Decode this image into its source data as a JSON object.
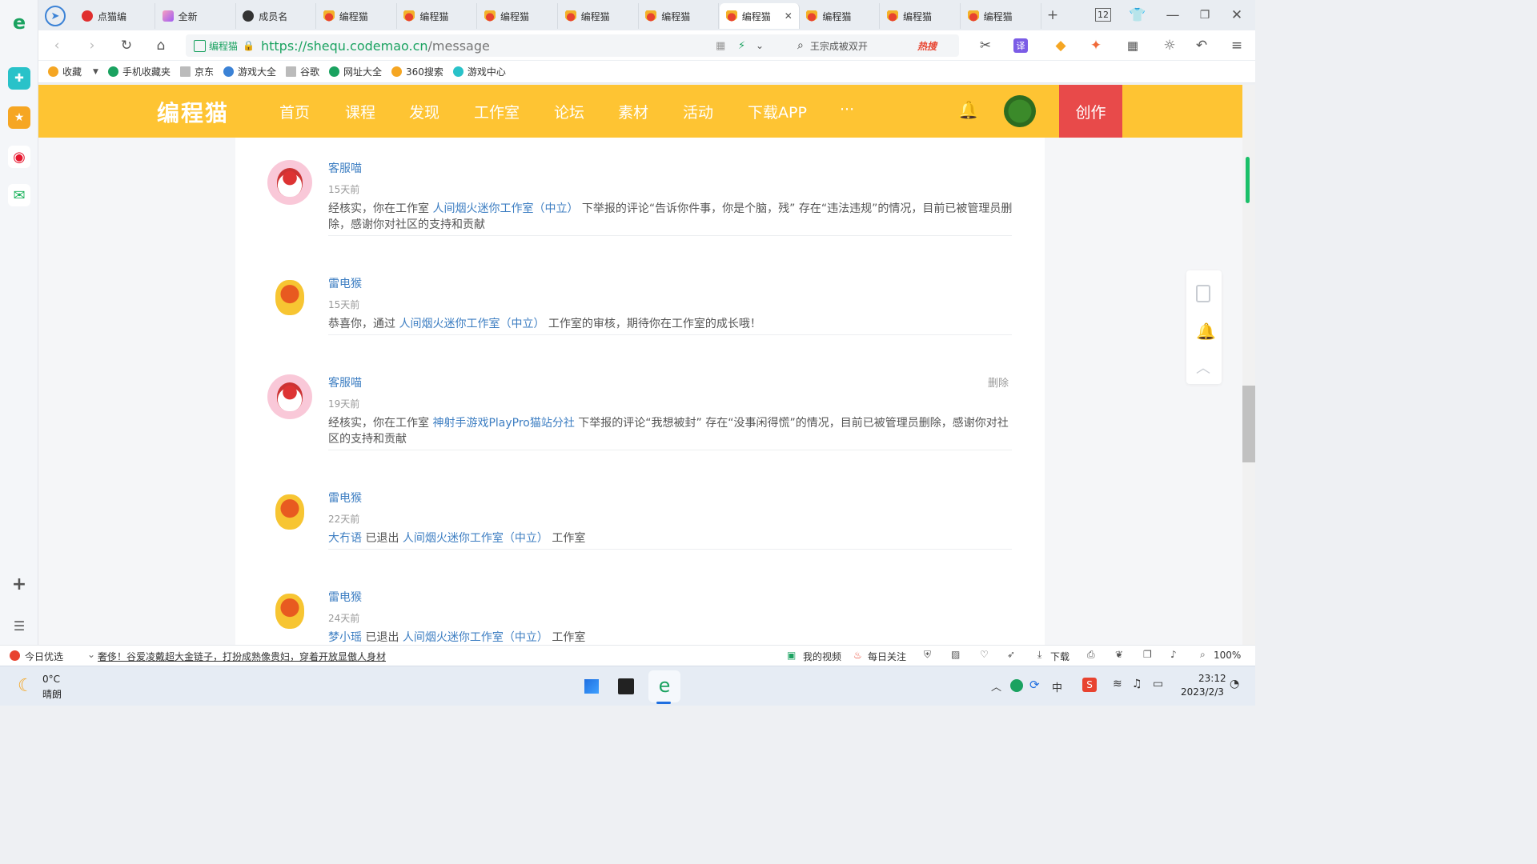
{
  "browser": {
    "tabs": [
      {
        "label": "点猫编",
        "icon": "red-play-icon",
        "active": false
      },
      {
        "label": "全新",
        "icon": "multicolor-icon",
        "active": false
      },
      {
        "label": "成员名",
        "icon": "dark-ball-icon",
        "active": false
      },
      {
        "label": "编程猫",
        "icon": "codemao-cat-icon",
        "active": false
      },
      {
        "label": "编程猫",
        "icon": "codemao-cat-icon",
        "active": false
      },
      {
        "label": "编程猫",
        "icon": "codemao-cat-icon",
        "active": false
      },
      {
        "label": "编程猫",
        "icon": "codemao-cat-icon",
        "active": false
      },
      {
        "label": "编程猫",
        "icon": "codemao-cat-icon",
        "active": false
      },
      {
        "label": "编程猫",
        "icon": "codemao-cat-icon",
        "active": true
      },
      {
        "label": "编程猫",
        "icon": "codemao-cat-icon",
        "active": false
      },
      {
        "label": "编程猫",
        "icon": "codemao-cat-icon",
        "active": false
      },
      {
        "label": "编程猫",
        "icon": "codemao-cat-icon",
        "active": false
      }
    ],
    "tab_count": "12",
    "address": {
      "site_name": "编程猫",
      "url_host": "https://shequ.codemao.cn",
      "url_path": "/message"
    },
    "search": {
      "query": "王宗成被双开",
      "hot_label": "热搜"
    },
    "bookmarks": [
      {
        "label": "收藏",
        "icon": "star-icon"
      },
      {
        "label": "手机收藏夹",
        "icon": "phone-icon"
      },
      {
        "label": "京东",
        "icon": "page-icon"
      },
      {
        "label": "游戏大全",
        "icon": "game-icon"
      },
      {
        "label": "谷歌",
        "icon": "page-icon"
      },
      {
        "label": "网址大全",
        "icon": "plus-circle-icon"
      },
      {
        "label": "360搜索",
        "icon": "search-360-icon"
      },
      {
        "label": "游戏中心",
        "icon": "gamepad-icon"
      }
    ]
  },
  "site": {
    "logo": "编程猫",
    "nav": [
      "首页",
      "课程",
      "发现",
      "工作室",
      "论坛",
      "素材",
      "活动",
      "下载APP",
      "···"
    ],
    "create_label": "创作"
  },
  "messages": [
    {
      "sender": "客服喵",
      "avatar": "pink",
      "time": "15天前",
      "parts": [
        {
          "t": "经核实，你在工作室 ",
          "link": false
        },
        {
          "t": "人间烟火迷你工作室（中立）",
          "link": true
        },
        {
          "t": " 下举报的评论“告诉你件事，你是个脑，残” 存在“违法违规”的情况，目前已被管理员删除，感谢你对社区的支持和贡献",
          "link": false
        }
      ],
      "delete_label": ""
    },
    {
      "sender": "雷电猴",
      "avatar": "yellow",
      "time": "15天前",
      "parts": [
        {
          "t": "恭喜你，通过 ",
          "link": false
        },
        {
          "t": "人间烟火迷你工作室（中立）",
          "link": true
        },
        {
          "t": " 工作室的审核，期待你在工作室的成长哦！",
          "link": false
        }
      ],
      "delete_label": ""
    },
    {
      "sender": "客服喵",
      "avatar": "pink",
      "time": "19天前",
      "parts": [
        {
          "t": "经核实，你在工作室 ",
          "link": false
        },
        {
          "t": "神射手游戏PlayPro猫站分社",
          "link": true
        },
        {
          "t": " 下举报的评论“我想被封” 存在“没事闲得慌”的情况，目前已被管理员删除，感谢你对社区的支持和贡献",
          "link": false
        }
      ],
      "delete_label": "删除"
    },
    {
      "sender": "雷电猴",
      "avatar": "yellow",
      "time": "22天前",
      "parts": [
        {
          "t": " 大冇语",
          "link": true
        },
        {
          "t": " 已退出 ",
          "link": false
        },
        {
          "t": "人间烟火迷你工作室（中立）",
          "link": true
        },
        {
          "t": " 工作室",
          "link": false
        }
      ],
      "delete_label": ""
    },
    {
      "sender": "雷电猴",
      "avatar": "yellow",
      "time": "24天前",
      "parts": [
        {
          "t": " 梦小瑶",
          "link": true
        },
        {
          "t": " 已退出 ",
          "link": false
        },
        {
          "t": "人间烟火迷你工作室（中立）",
          "link": true
        },
        {
          "t": " 工作室",
          "link": false
        }
      ],
      "delete_label": ""
    }
  ],
  "statusbar": {
    "today_label": "今日优选",
    "news": "奢侈！谷爱凌戴超大金链子，打扮成熟像贵妇，穿着开放显傲人身材",
    "my_video": "我的视频",
    "daily_focus": "每日关注",
    "download": "下载",
    "zoom": "100%"
  },
  "taskbar": {
    "temp": "0°C",
    "weather": "晴朗",
    "ime": "中",
    "time": "23:12",
    "date": "2023/2/3"
  },
  "colors": {
    "brand_orange": "#fec433",
    "create_red": "#e84a4a",
    "link_blue": "#3d7ec2"
  }
}
